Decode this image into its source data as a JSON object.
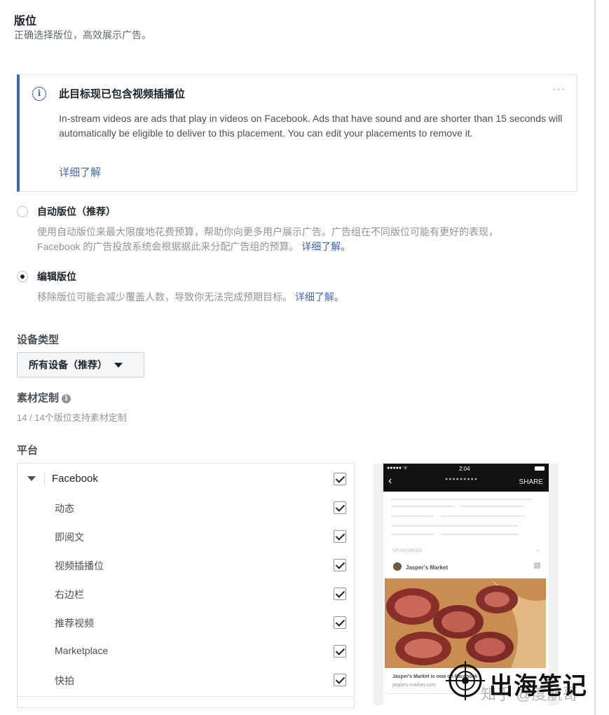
{
  "header": {
    "title": "版位",
    "subtitle": "正确选择版位，高效展示广告。"
  },
  "notice": {
    "title": "此目标现已包含视频插播位",
    "body": "In-stream videos are ads that play in videos on Facebook. Ads that have sound and are shorter than 15 seconds will automatically be eligible to deliver to this placement. You can edit your placements to remove it.",
    "link": "详细了解",
    "more": "···",
    "icon": "info-icon"
  },
  "placement_options": [
    {
      "label": "自动版位（推荐）",
      "desc_line1": "使用自动版位来最大限度地花费预算，帮助你向更多用户展示广告。广告组在不同版位可能有更好的表现，",
      "desc_line2": "Facebook 的广告投放系统会根据据此来分配广告组的预算。",
      "link": "详细了解。",
      "selected": false
    },
    {
      "label": "编辑版位",
      "desc_line1": "移除版位可能会减少覆盖人数，导致你无法完成预期目标。",
      "link": "详细了解。",
      "selected": true
    }
  ],
  "device": {
    "label": "设备类型",
    "value": "所有设备（推荐）"
  },
  "asset_customization": {
    "label": "素材定制",
    "info": "14 / 14个版位支持素材定制"
  },
  "platforms": {
    "label": "平台",
    "group": "Facebook",
    "items": [
      "动态",
      "即阅文",
      "视频插播位",
      "右边栏",
      "推荐视频",
      "Marketplace",
      "快拍"
    ]
  },
  "preview": {
    "time": "2:04",
    "signal": "●●●●● ᯤ",
    "share": "SHARE",
    "sponsored": "SPONSORED",
    "page_name": "Jasper's Market",
    "caption": "Jasper's Market is now on Facebook",
    "url": "jaspers-market.com"
  },
  "watermark": {
    "text": "出海笔记",
    "sub": "知乎 @度航哥"
  }
}
